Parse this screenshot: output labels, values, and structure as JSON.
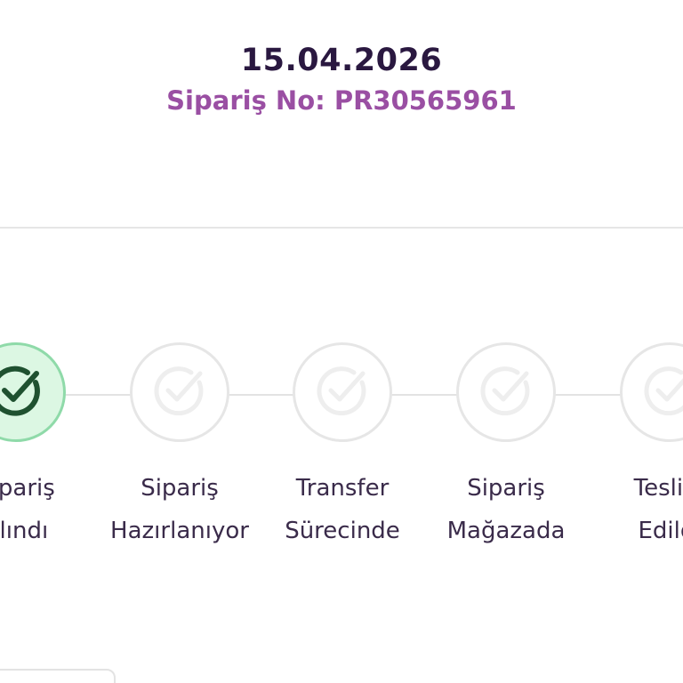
{
  "order": {
    "date": "15.04.2026",
    "number_text": "Sipariş No: PR30565961"
  },
  "steps": [
    {
      "line1": "Sipariş",
      "line2": "Alındı",
      "status": "completed",
      "icon": "check-circle-icon"
    },
    {
      "line1": "Sipariş",
      "line2": "Hazırlanıyor",
      "status": "pending",
      "icon": "check-circle-icon"
    },
    {
      "line1": "Transfer",
      "line2": "Sürecinde",
      "status": "pending",
      "icon": "check-circle-icon"
    },
    {
      "line1": "Sipariş",
      "line2": "Mağazada",
      "status": "pending",
      "icon": "check-circle-icon"
    },
    {
      "line1": "Teslim",
      "line2": "Edildi",
      "status": "pending",
      "icon": "check-circle-icon"
    }
  ],
  "colors": {
    "date_text": "#2a1840",
    "order_no_text": "#9a4fa3",
    "completed_fill": "#dcf7e3",
    "completed_border": "#8fdaa9",
    "completed_check": "#1f5130",
    "pending_border": "#e6e6e6",
    "pending_check": "#eeeeee"
  }
}
